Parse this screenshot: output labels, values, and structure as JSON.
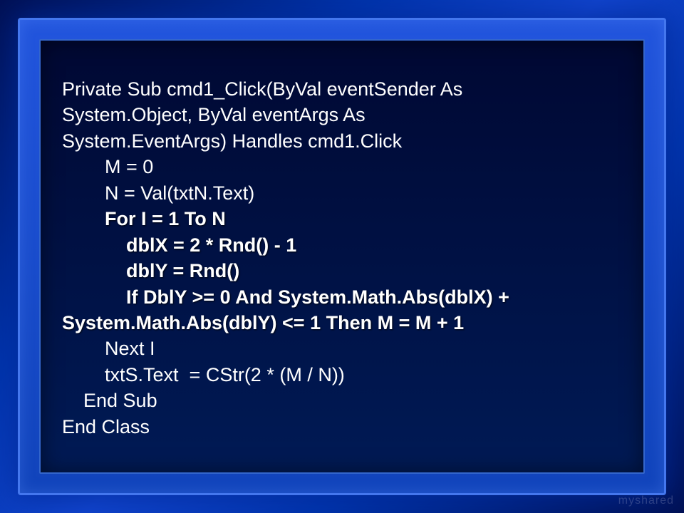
{
  "code": {
    "line1": "Private Sub cmd1_Click(ByVal eventSender As",
    "line2": "System.Object, ByVal eventArgs As",
    "line3": "System.EventArgs) Handles cmd1.Click",
    "line4": "        M = 0",
    "line5": "        N = Val(txtN.Text)",
    "line6": "        For I = 1 To N",
    "line7": "            dblX = 2 * Rnd() - 1",
    "line8": "            dblY = Rnd()",
    "line9": "            If DblY >= 0 And System.Math.Abs(dblX) +",
    "line10": "System.Math.Abs(dblY) <= 1 Then M = M + 1",
    "line11": "        Next I",
    "line12": "        txtS.Text  = CStr(2 * (M / N))",
    "line13": "    End Sub",
    "line14": "End Class"
  },
  "watermark": "myshared"
}
